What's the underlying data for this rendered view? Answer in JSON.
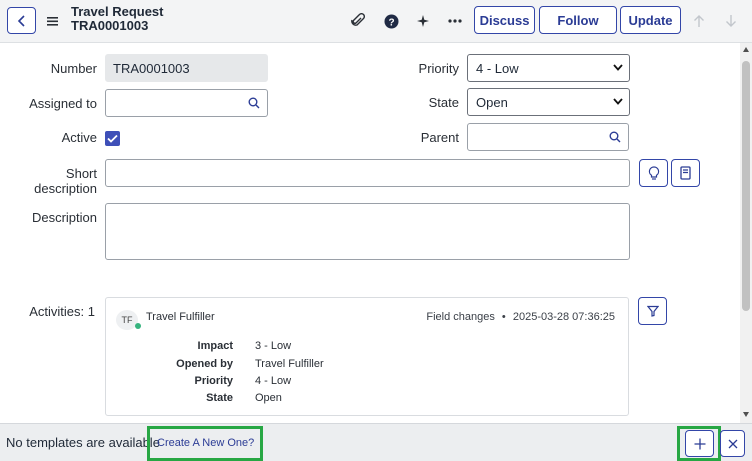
{
  "header": {
    "record_type": "Travel Request",
    "record_number": "TRA0001003",
    "buttons": {
      "discuss": "Discuss",
      "follow": "Follow",
      "update": "Update"
    },
    "icons": [
      "back-icon",
      "menu-icon",
      "attachment-icon",
      "help-icon",
      "sparkle-icon",
      "more-icon",
      "arrow-up-icon",
      "arrow-down-icon"
    ]
  },
  "form": {
    "number": {
      "label": "Number",
      "value": "TRA0001003"
    },
    "assigned_to": {
      "label": "Assigned to",
      "value": ""
    },
    "active": {
      "label": "Active",
      "checked": true
    },
    "short_description": {
      "label_line1": "Short",
      "label_line2": "description",
      "value": ""
    },
    "description": {
      "label": "Description",
      "value": ""
    },
    "priority": {
      "label": "Priority",
      "value": "4 - Low"
    },
    "state": {
      "label": "State",
      "value": "Open"
    },
    "parent": {
      "label": "Parent",
      "value": ""
    }
  },
  "activities": {
    "label": "Activities: 1",
    "entry": {
      "avatar_initials": "TF",
      "user": "Travel Fulfiller",
      "type": "Field changes",
      "separator": "•",
      "timestamp": "2025-03-28 07:36:25",
      "changes": [
        {
          "field": "Impact",
          "value": "3 - Low"
        },
        {
          "field": "Opened by",
          "value": "Travel Fulfiller"
        },
        {
          "field": "Priority",
          "value": "4 - Low"
        },
        {
          "field": "State",
          "value": "Open"
        }
      ]
    }
  },
  "footer": {
    "message": "No templates are available",
    "link": "Create A New One?"
  },
  "colors": {
    "accent": "#3346a8",
    "highlight": "#27a744",
    "active_dot": "#36b37e"
  }
}
